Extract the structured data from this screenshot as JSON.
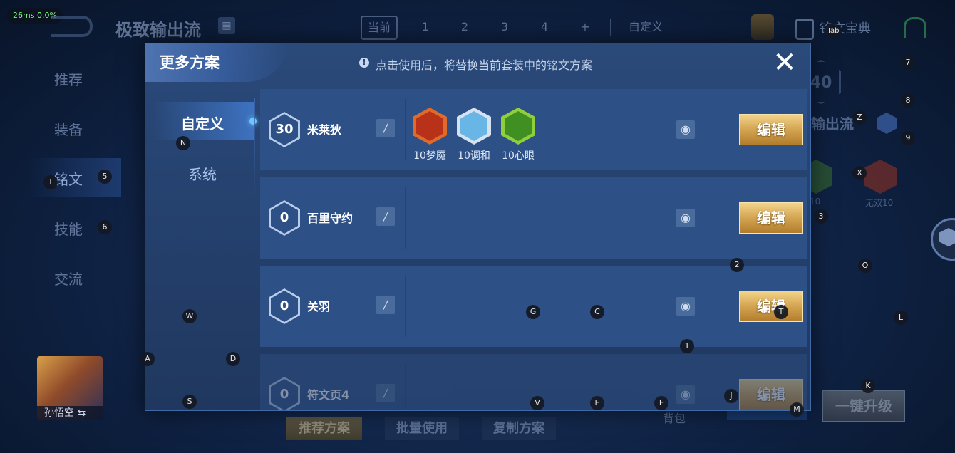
{
  "hud": {
    "ping": "26ms  0.0%"
  },
  "background": {
    "title": "极致输出流",
    "top_tabs": [
      "当前",
      "1",
      "2",
      "3",
      "4",
      "+"
    ],
    "custom_label": "自定义",
    "rune_book_label": "铭文宝典",
    "sidebar": [
      "推荐",
      "装备",
      "铭文",
      "技能",
      "交流"
    ],
    "hero_name": "孙悟空",
    "bottom_buttons": [
      "推荐方案",
      "批量使用",
      "复制方案"
    ],
    "bag_label": "背包",
    "upgrade_button": "一键升级",
    "panel_badge": "40",
    "panel_flow_label": "输出流",
    "panel_rune_labels": [
      "10",
      "无双10"
    ]
  },
  "modal": {
    "title": "更多方案",
    "notice": "点击使用后，将替换当前套装中的铭文方案",
    "close_icon": "close-icon",
    "tabs": [
      "自定义",
      "系统"
    ],
    "active_tab": "自定义",
    "edit_label": "编辑",
    "presets": [
      {
        "level": "30",
        "name": "米莱狄",
        "runes": [
          {
            "label": "10梦魇",
            "color_outer": "#e06a2a",
            "color_inner": "#b8321a"
          },
          {
            "label": "10调和",
            "color_outer": "#d6e2f0",
            "color_inner": "#67b6e6"
          },
          {
            "label": "10心眼",
            "color_outer": "#8fcf3a",
            "color_inner": "#3f8f22"
          }
        ]
      },
      {
        "level": "0",
        "name": "百里守约",
        "runes": []
      },
      {
        "level": "0",
        "name": "关羽",
        "runes": []
      },
      {
        "level": "0",
        "name": "符文页4",
        "runes": []
      }
    ]
  },
  "keys": [
    "Tab",
    "7",
    "8",
    "9",
    "Z",
    "X",
    "3",
    "O",
    "L",
    "K",
    "M",
    "2",
    "1",
    "J",
    "F",
    "E",
    "V",
    "C",
    "G",
    "T",
    "N",
    "5",
    "T",
    "6",
    "W",
    "A",
    "D",
    "S"
  ],
  "colors": {
    "accent_gold": "#d3a451",
    "modal_bg": "#243f6b",
    "row_bg": "#2d5086",
    "highlight": "#6ec4ff"
  }
}
